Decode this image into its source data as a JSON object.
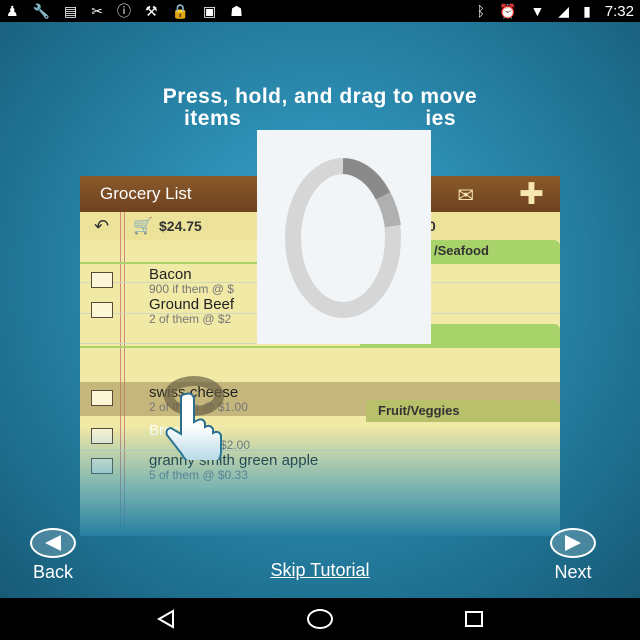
{
  "status": {
    "time": "7:32"
  },
  "tutorial": {
    "instruction_line1": "Press, hold, and drag to move",
    "instruction_line2": "items",
    "instruction_line2_tail": "ies",
    "back_label": "Back",
    "next_label": "Next",
    "skip_label": "Skip Tutorial"
  },
  "app": {
    "title": "Grocery List",
    "total": "$24.75",
    "total2": "0",
    "categories": {
      "seafood": "/Seafood",
      "fruit": "Fruit/Veggies"
    },
    "items": [
      {
        "name": "Bacon",
        "sub": "900 if them @ $"
      },
      {
        "name": "Ground Beef",
        "sub": "2 of them @ $2"
      },
      {
        "name": "swiss cheese",
        "sub": "2 of them @ $1.00"
      },
      {
        "name": "Broccoli",
        "sub": "$2.00"
      },
      {
        "name": "granny smith green apple",
        "sub": "5 of them @ $0.33"
      }
    ]
  },
  "colors": {
    "accent": "#8b5a2b",
    "category_green": "#a8d26a",
    "background_blue": "#2d8fb4"
  }
}
